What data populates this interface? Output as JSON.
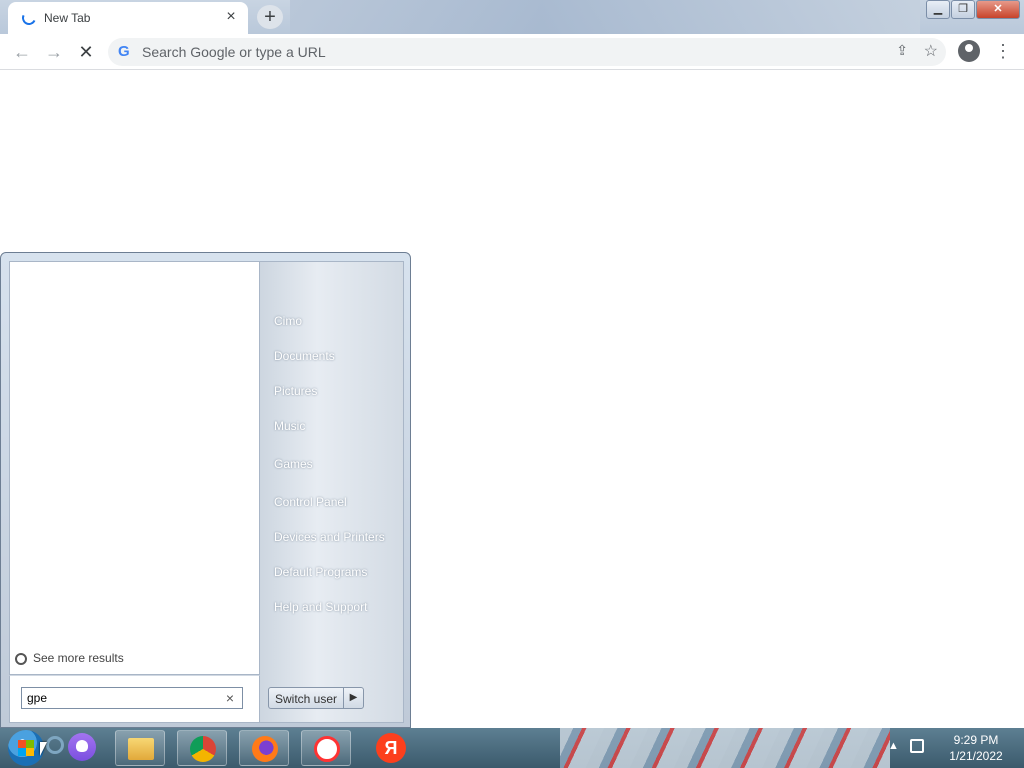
{
  "browser": {
    "tab_title": "New Tab",
    "tab_close": "×",
    "new_tab": "+",
    "window_buttons": {
      "minimize": "▁",
      "restore": "❐",
      "close": "✕"
    },
    "nav": {
      "back": "←",
      "forward": "→",
      "reload": "✕"
    },
    "omnibox_placeholder": "Search Google or type a URL",
    "omnibox_g": "G",
    "share_icon": "⇪",
    "star_icon": "☆",
    "menu_icon": "⋮"
  },
  "start_menu": {
    "right_items": [
      "Сіmо",
      "Documents",
      "Pictures",
      "Music",
      "Games",
      "Control Panel",
      "Devices and Printers",
      "Default Programs",
      "Help and Support"
    ],
    "see_more": "See more results",
    "search_value": "gpe",
    "search_clear": "×",
    "switch_user": "Switch user",
    "switch_arrow": "▶"
  },
  "taskbar": {
    "clock_time": "9:29 PM",
    "clock_date": "1/21/2022",
    "tray_up": "▲",
    "yandex_letter": "Я"
  }
}
